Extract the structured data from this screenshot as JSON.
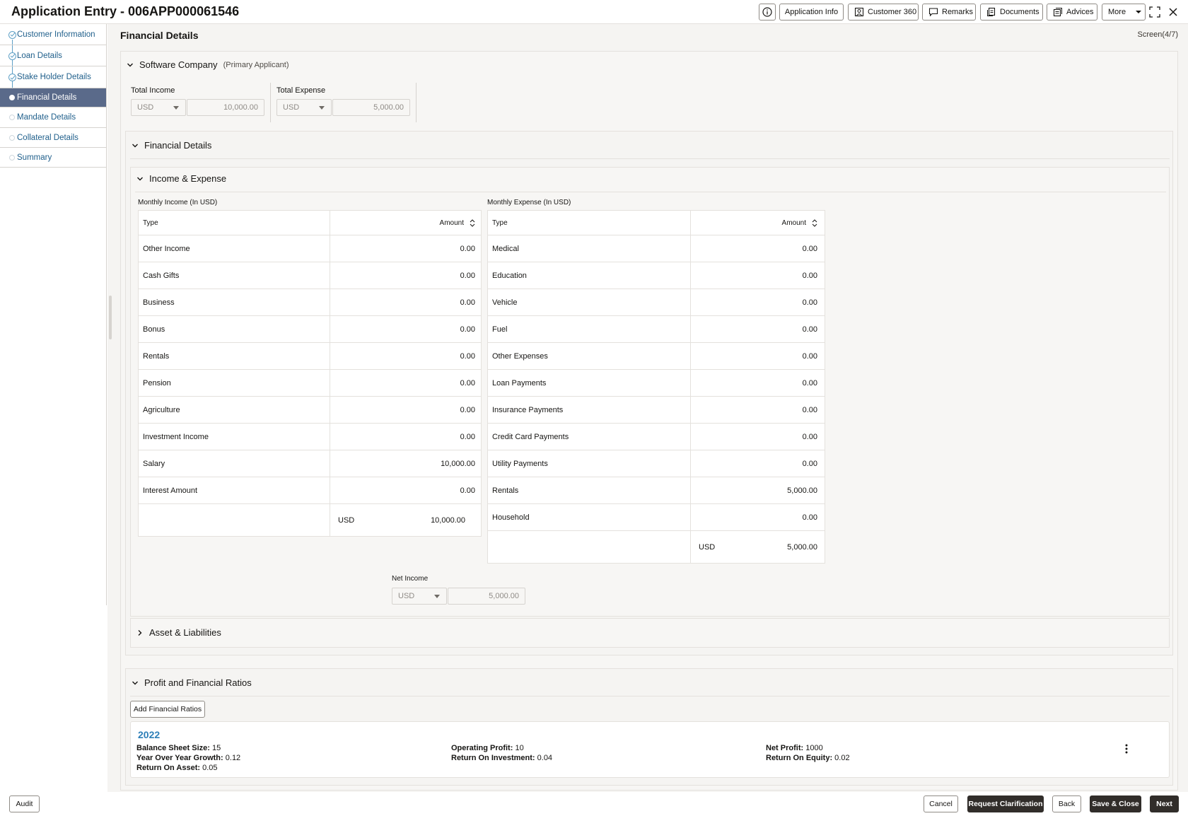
{
  "header": {
    "title": "Application Entry - 006APP000061546",
    "buttons": {
      "application_info": "Application Info",
      "customer_360": "Customer 360",
      "remarks": "Remarks",
      "documents": "Documents",
      "advices": "Advices",
      "more": "More"
    }
  },
  "sidebar": {
    "items": [
      {
        "label": "Customer Information",
        "state": "visited"
      },
      {
        "label": "Loan Details",
        "state": "visited"
      },
      {
        "label": "Stake Holder Details",
        "state": "visited"
      },
      {
        "label": "Financial Details",
        "state": "active"
      },
      {
        "label": "Mandate Details",
        "state": "pending"
      },
      {
        "label": "Collateral Details",
        "state": "pending"
      },
      {
        "label": "Summary",
        "state": "pending"
      }
    ]
  },
  "page": {
    "title": "Financial Details",
    "screen": "Screen(4/7)"
  },
  "applicant": {
    "name": "Software Company",
    "role": "(Primary Applicant)",
    "total_income": {
      "label": "Total Income",
      "currency": "USD",
      "value": "10,000.00"
    },
    "total_expense": {
      "label": "Total Expense",
      "currency": "USD",
      "value": "5,000.00"
    }
  },
  "financial_details": {
    "title": "Financial Details",
    "income_expense": {
      "title": "Income & Expense",
      "income": {
        "caption": "Monthly Income (In USD)",
        "col_type": "Type",
        "col_amount": "Amount",
        "rows": [
          {
            "type": "Other Income",
            "amount": "0.00"
          },
          {
            "type": "Cash Gifts",
            "amount": "0.00"
          },
          {
            "type": "Business",
            "amount": "0.00"
          },
          {
            "type": "Bonus",
            "amount": "0.00"
          },
          {
            "type": "Rentals",
            "amount": "0.00"
          },
          {
            "type": "Pension",
            "amount": "0.00"
          },
          {
            "type": "Agriculture",
            "amount": "0.00"
          },
          {
            "type": "Investment Income",
            "amount": "0.00"
          },
          {
            "type": "Salary",
            "amount": "10,000.00"
          },
          {
            "type": "Interest Amount",
            "amount": "0.00"
          }
        ],
        "total_currency": "USD",
        "total": "10,000.00"
      },
      "expense": {
        "caption": "Monthly Expense (In USD)",
        "col_type": "Type",
        "col_amount": "Amount",
        "rows": [
          {
            "type": "Medical",
            "amount": "0.00"
          },
          {
            "type": "Education",
            "amount": "0.00"
          },
          {
            "type": "Vehicle",
            "amount": "0.00"
          },
          {
            "type": "Fuel",
            "amount": "0.00"
          },
          {
            "type": "Other Expenses",
            "amount": "0.00"
          },
          {
            "type": "Loan Payments",
            "amount": "0.00"
          },
          {
            "type": "Insurance Payments",
            "amount": "0.00"
          },
          {
            "type": "Credit Card Payments",
            "amount": "0.00"
          },
          {
            "type": "Utility Payments",
            "amount": "0.00"
          },
          {
            "type": "Rentals",
            "amount": "5,000.00"
          },
          {
            "type": "Household",
            "amount": "0.00"
          }
        ],
        "total_currency": "USD",
        "total": "5,000.00"
      },
      "net_income": {
        "label": "Net Income",
        "currency": "USD",
        "value": "5,000.00"
      }
    },
    "assets_liabilities": {
      "title": "Asset & Liabilities"
    }
  },
  "ratios": {
    "title": "Profit and Financial Ratios",
    "add_button": "Add Financial Ratios",
    "card": {
      "year": "2022",
      "items": [
        {
          "label": "Balance Sheet Size:",
          "value": "15"
        },
        {
          "label": "Year Over Year Growth:",
          "value": "0.12"
        },
        {
          "label": "Return On Asset:",
          "value": "0.05"
        },
        {
          "label": "Operating Profit:",
          "value": "10"
        },
        {
          "label": "Return On Investment:",
          "value": "0.04"
        },
        {
          "label": "Net Profit:",
          "value": "1000"
        },
        {
          "label": "Return On Equity:",
          "value": "0.02"
        }
      ]
    }
  },
  "footer": {
    "audit": "Audit",
    "cancel": "Cancel",
    "request_clarification": "Request Clarification",
    "back": "Back",
    "save_close": "Save & Close",
    "next": "Next"
  },
  "colors": {
    "active_nav": "#5a6a8a",
    "link": "#1f5f8b",
    "year_accent": "#2d7fb8",
    "dark_button": "#312d2a"
  },
  "icons": [
    "info-icon",
    "person-card-icon",
    "chat-icon",
    "documents-icon",
    "advices-icon",
    "fullscreen-icon",
    "close-icon",
    "chevron-down-icon",
    "chevron-right-icon",
    "sort-icon",
    "kebab-menu-icon",
    "check-circle-icon"
  ]
}
